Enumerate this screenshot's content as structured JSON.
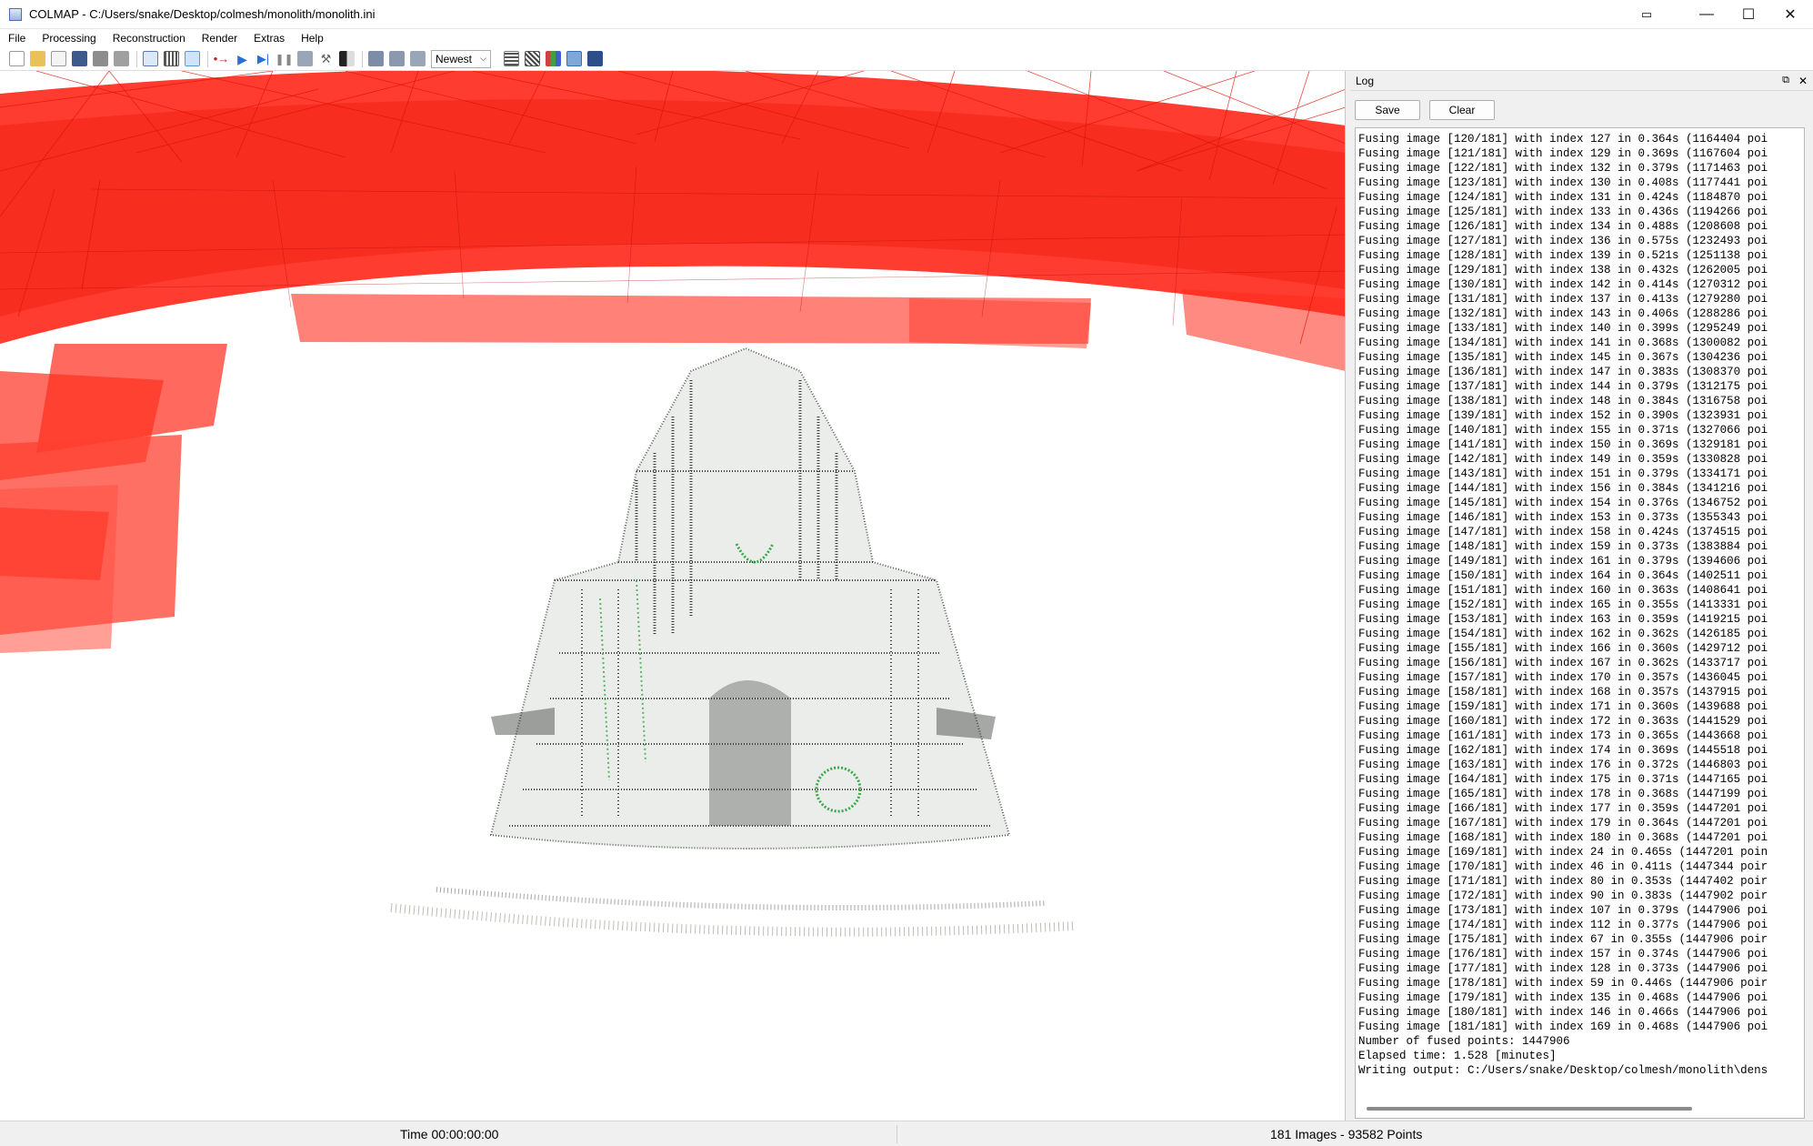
{
  "window": {
    "title": "COLMAP - C:/Users/snake/Desktop/colmesh/monolith/monolith.ini"
  },
  "menu": [
    "File",
    "Processing",
    "Reconstruction",
    "Render",
    "Extras",
    "Help"
  ],
  "toolbar": {
    "sort_value": "Newest"
  },
  "log": {
    "title": "Log",
    "save_label": "Save",
    "clear_label": "Clear",
    "lines": [
      "Fusing image [120/181] with index 127 in 0.364s (1164404 poi",
      "Fusing image [121/181] with index 129 in 0.369s (1167604 poi",
      "Fusing image [122/181] with index 132 in 0.379s (1171463 poi",
      "Fusing image [123/181] with index 130 in 0.408s (1177441 poi",
      "Fusing image [124/181] with index 131 in 0.424s (1184870 poi",
      "Fusing image [125/181] with index 133 in 0.436s (1194266 poi",
      "Fusing image [126/181] with index 134 in 0.488s (1208608 poi",
      "Fusing image [127/181] with index 136 in 0.575s (1232493 poi",
      "Fusing image [128/181] with index 139 in 0.521s (1251138 poi",
      "Fusing image [129/181] with index 138 in 0.432s (1262005 poi",
      "Fusing image [130/181] with index 142 in 0.414s (1270312 poi",
      "Fusing image [131/181] with index 137 in 0.413s (1279280 poi",
      "Fusing image [132/181] with index 143 in 0.406s (1288286 poi",
      "Fusing image [133/181] with index 140 in 0.399s (1295249 poi",
      "Fusing image [134/181] with index 141 in 0.368s (1300082 poi",
      "Fusing image [135/181] with index 145 in 0.367s (1304236 poi",
      "Fusing image [136/181] with index 147 in 0.383s (1308370 poi",
      "Fusing image [137/181] with index 144 in 0.379s (1312175 poi",
      "Fusing image [138/181] with index 148 in 0.384s (1316758 poi",
      "Fusing image [139/181] with index 152 in 0.390s (1323931 poi",
      "Fusing image [140/181] with index 155 in 0.371s (1327066 poi",
      "Fusing image [141/181] with index 150 in 0.369s (1329181 poi",
      "Fusing image [142/181] with index 149 in 0.359s (1330828 poi",
      "Fusing image [143/181] with index 151 in 0.379s (1334171 poi",
      "Fusing image [144/181] with index 156 in 0.384s (1341216 poi",
      "Fusing image [145/181] with index 154 in 0.376s (1346752 poi",
      "Fusing image [146/181] with index 153 in 0.373s (1355343 poi",
      "Fusing image [147/181] with index 158 in 0.424s (1374515 poi",
      "Fusing image [148/181] with index 159 in 0.373s (1383884 poi",
      "Fusing image [149/181] with index 161 in 0.379s (1394606 poi",
      "Fusing image [150/181] with index 164 in 0.364s (1402511 poi",
      "Fusing image [151/181] with index 160 in 0.363s (1408641 poi",
      "Fusing image [152/181] with index 165 in 0.355s (1413331 poi",
      "Fusing image [153/181] with index 163 in 0.359s (1419215 poi",
      "Fusing image [154/181] with index 162 in 0.362s (1426185 poi",
      "Fusing image [155/181] with index 166 in 0.360s (1429712 poi",
      "Fusing image [156/181] with index 167 in 0.362s (1433717 poi",
      "Fusing image [157/181] with index 170 in 0.357s (1436045 poi",
      "Fusing image [158/181] with index 168 in 0.357s (1437915 poi",
      "Fusing image [159/181] with index 171 in 0.360s (1439688 poi",
      "Fusing image [160/181] with index 172 in 0.363s (1441529 poi",
      "Fusing image [161/181] with index 173 in 0.365s (1443668 poi",
      "Fusing image [162/181] with index 174 in 0.369s (1445518 poi",
      "Fusing image [163/181] with index 176 in 0.372s (1446803 poi",
      "Fusing image [164/181] with index 175 in 0.371s (1447165 poi",
      "Fusing image [165/181] with index 178 in 0.368s (1447199 poi",
      "Fusing image [166/181] with index 177 in 0.359s (1447201 poi",
      "Fusing image [167/181] with index 179 in 0.364s (1447201 poi",
      "Fusing image [168/181] with index 180 in 0.368s (1447201 poi",
      "Fusing image [169/181] with index 24 in 0.465s (1447201 poin",
      "Fusing image [170/181] with index 46 in 0.411s (1447344 poir",
      "Fusing image [171/181] with index 80 in 0.353s (1447402 poir",
      "Fusing image [172/181] with index 90 in 0.383s (1447902 poir",
      "Fusing image [173/181] with index 107 in 0.379s (1447906 poi",
      "Fusing image [174/181] with index 112 in 0.377s (1447906 poi",
      "Fusing image [175/181] with index 67 in 0.355s (1447906 poir",
      "Fusing image [176/181] with index 157 in 0.374s (1447906 poi",
      "Fusing image [177/181] with index 128 in 0.373s (1447906 poi",
      "Fusing image [178/181] with index 59 in 0.446s (1447906 poir",
      "Fusing image [179/181] with index 135 in 0.468s (1447906 poi",
      "Fusing image [180/181] with index 146 in 0.466s (1447906 poi",
      "Fusing image [181/181] with index 169 in 0.468s (1447906 poi",
      "Number of fused points: 1447906",
      "Elapsed time: 1.528 [minutes]",
      "Writing output: C:/Users/snake/Desktop/colmesh/monolith\\dens"
    ]
  },
  "status": {
    "time": "Time 00:00:00:00",
    "counts": "181 Images - 93582 Points"
  },
  "colors": {
    "camera_red": "#ff1a0a",
    "point_dark": "#3a3f3a",
    "point_green": "#3aa84a"
  }
}
